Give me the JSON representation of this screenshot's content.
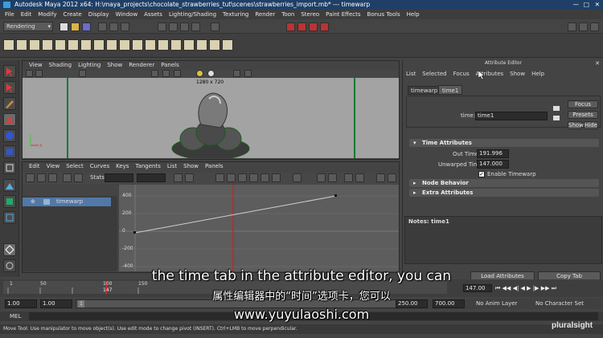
{
  "window": {
    "title": "Autodesk Maya 2012 x64: H:\\maya_projects\\chocolate_strawberries_tut\\scenes\\strawberries_import.mb*  ---  timewarp"
  },
  "menubar": [
    "File",
    "Edit",
    "Modify",
    "Create",
    "Display",
    "Window",
    "Assets",
    "Lighting/Shading",
    "Texturing",
    "Render",
    "Toon",
    "Stereo",
    "Paint Effects",
    "Bonus Tools",
    "Help"
  ],
  "status_line": {
    "menu_set": "Rendering"
  },
  "viewport": {
    "menu": [
      "View",
      "Shading",
      "Lighting",
      "Show",
      "Renderer",
      "Panels"
    ],
    "resolution": "1280 x 720"
  },
  "graph_editor": {
    "menu": [
      "Edit",
      "View",
      "Select",
      "Curves",
      "Keys",
      "Tangents",
      "List",
      "Show",
      "Panels"
    ],
    "stats_label": "Stats",
    "outliner_item": "timewarp",
    "y_ticks": [
      "400",
      "200",
      "0",
      "-200",
      "-400"
    ]
  },
  "attribute_editor": {
    "title": "Attribute Editor",
    "menu": [
      "List",
      "Selected",
      "Focus",
      "Attributes",
      "Show",
      "Help"
    ],
    "tabs": [
      "timewarp",
      "time1"
    ],
    "name_label": "time:",
    "name_value": "time1",
    "buttons": {
      "focus": "Focus",
      "presets": "Presets",
      "show": "Show",
      "hide": "Hide"
    },
    "sections": {
      "time_attributes": "Time Attributes",
      "node_behavior": "Node Behavior",
      "extra_attributes": "Extra Attributes"
    },
    "out_time_label": "Out Time",
    "out_time_value": "191.996",
    "unwarped_time_label": "Unwarped Time",
    "unwarped_time_value": "147.000",
    "enable_timewarp_label": "Enable Timewarp",
    "enable_timewarp_checked": true,
    "notes_label": "Notes:  time1",
    "load_attributes": "Load Attributes",
    "copy_tab": "Copy Tab"
  },
  "timeline": {
    "ticks": [
      "1",
      "50",
      "100",
      "150"
    ],
    "current_frame_label": "147",
    "current_frame_field": "147.00"
  },
  "range_slider": {
    "start_time": "1.00",
    "start_playback": "1.00",
    "range_start_handle": "1",
    "end_field_1": "250.00",
    "end_field_2": "700.00",
    "anim_layer": "No Anim Layer",
    "character": "No Character Set"
  },
  "mel": {
    "label": "MEL"
  },
  "help_line": "Move Tool: Use manipulator to move object(s). Use edit mode to change pivot (INSERT). Ctrl+LMB to move perpendicular.",
  "subtitles": {
    "english": "the time tab in the attribute editor, you can",
    "chinese": "属性编辑器中的“时间”选项卡，您可以",
    "website": "www.yuyulaoshi.com"
  },
  "watermark": "pluralsight"
}
